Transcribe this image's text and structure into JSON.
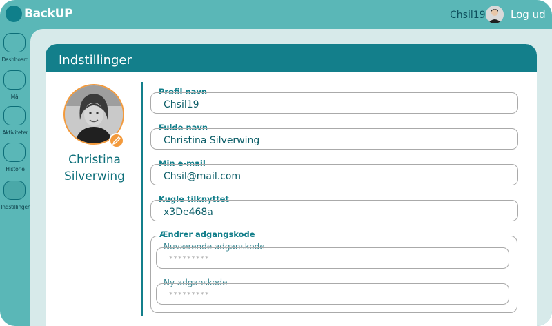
{
  "app": {
    "name": "BackUP",
    "username": "Chsil19",
    "logout_label": "Log ud"
  },
  "sidebar": {
    "items": [
      {
        "label": "Dashboard"
      },
      {
        "label": "Mål"
      },
      {
        "label": "Aktiviteter"
      },
      {
        "label": "Historie"
      },
      {
        "label": "Indstillinger",
        "active": true
      }
    ]
  },
  "settings": {
    "title": "Indstillinger",
    "profile": {
      "first_name": "Christina",
      "last_name": "Silverwing"
    },
    "fields": {
      "profile_name": {
        "label": "Profil navn",
        "value": "Chsil19"
      },
      "full_name": {
        "label": "Fulde navn",
        "value": "Christina Silverwing"
      },
      "email": {
        "label": "Min e-mail",
        "value": "Chsil@mail.com"
      },
      "ball": {
        "label": "Kugle tilknyttet",
        "value": "x3De468a"
      }
    },
    "password": {
      "group_label": "Ændrer adgangskode",
      "current": {
        "label": "Nuværende adganskode",
        "value": "*********"
      },
      "new": {
        "label": "Ny adganskode",
        "value": "*********"
      }
    }
  },
  "colors": {
    "frame": "#5ab7b7",
    "accent": "#137f8b",
    "content_bg": "#d7eaea",
    "photo_ring": "#f39a3c"
  }
}
